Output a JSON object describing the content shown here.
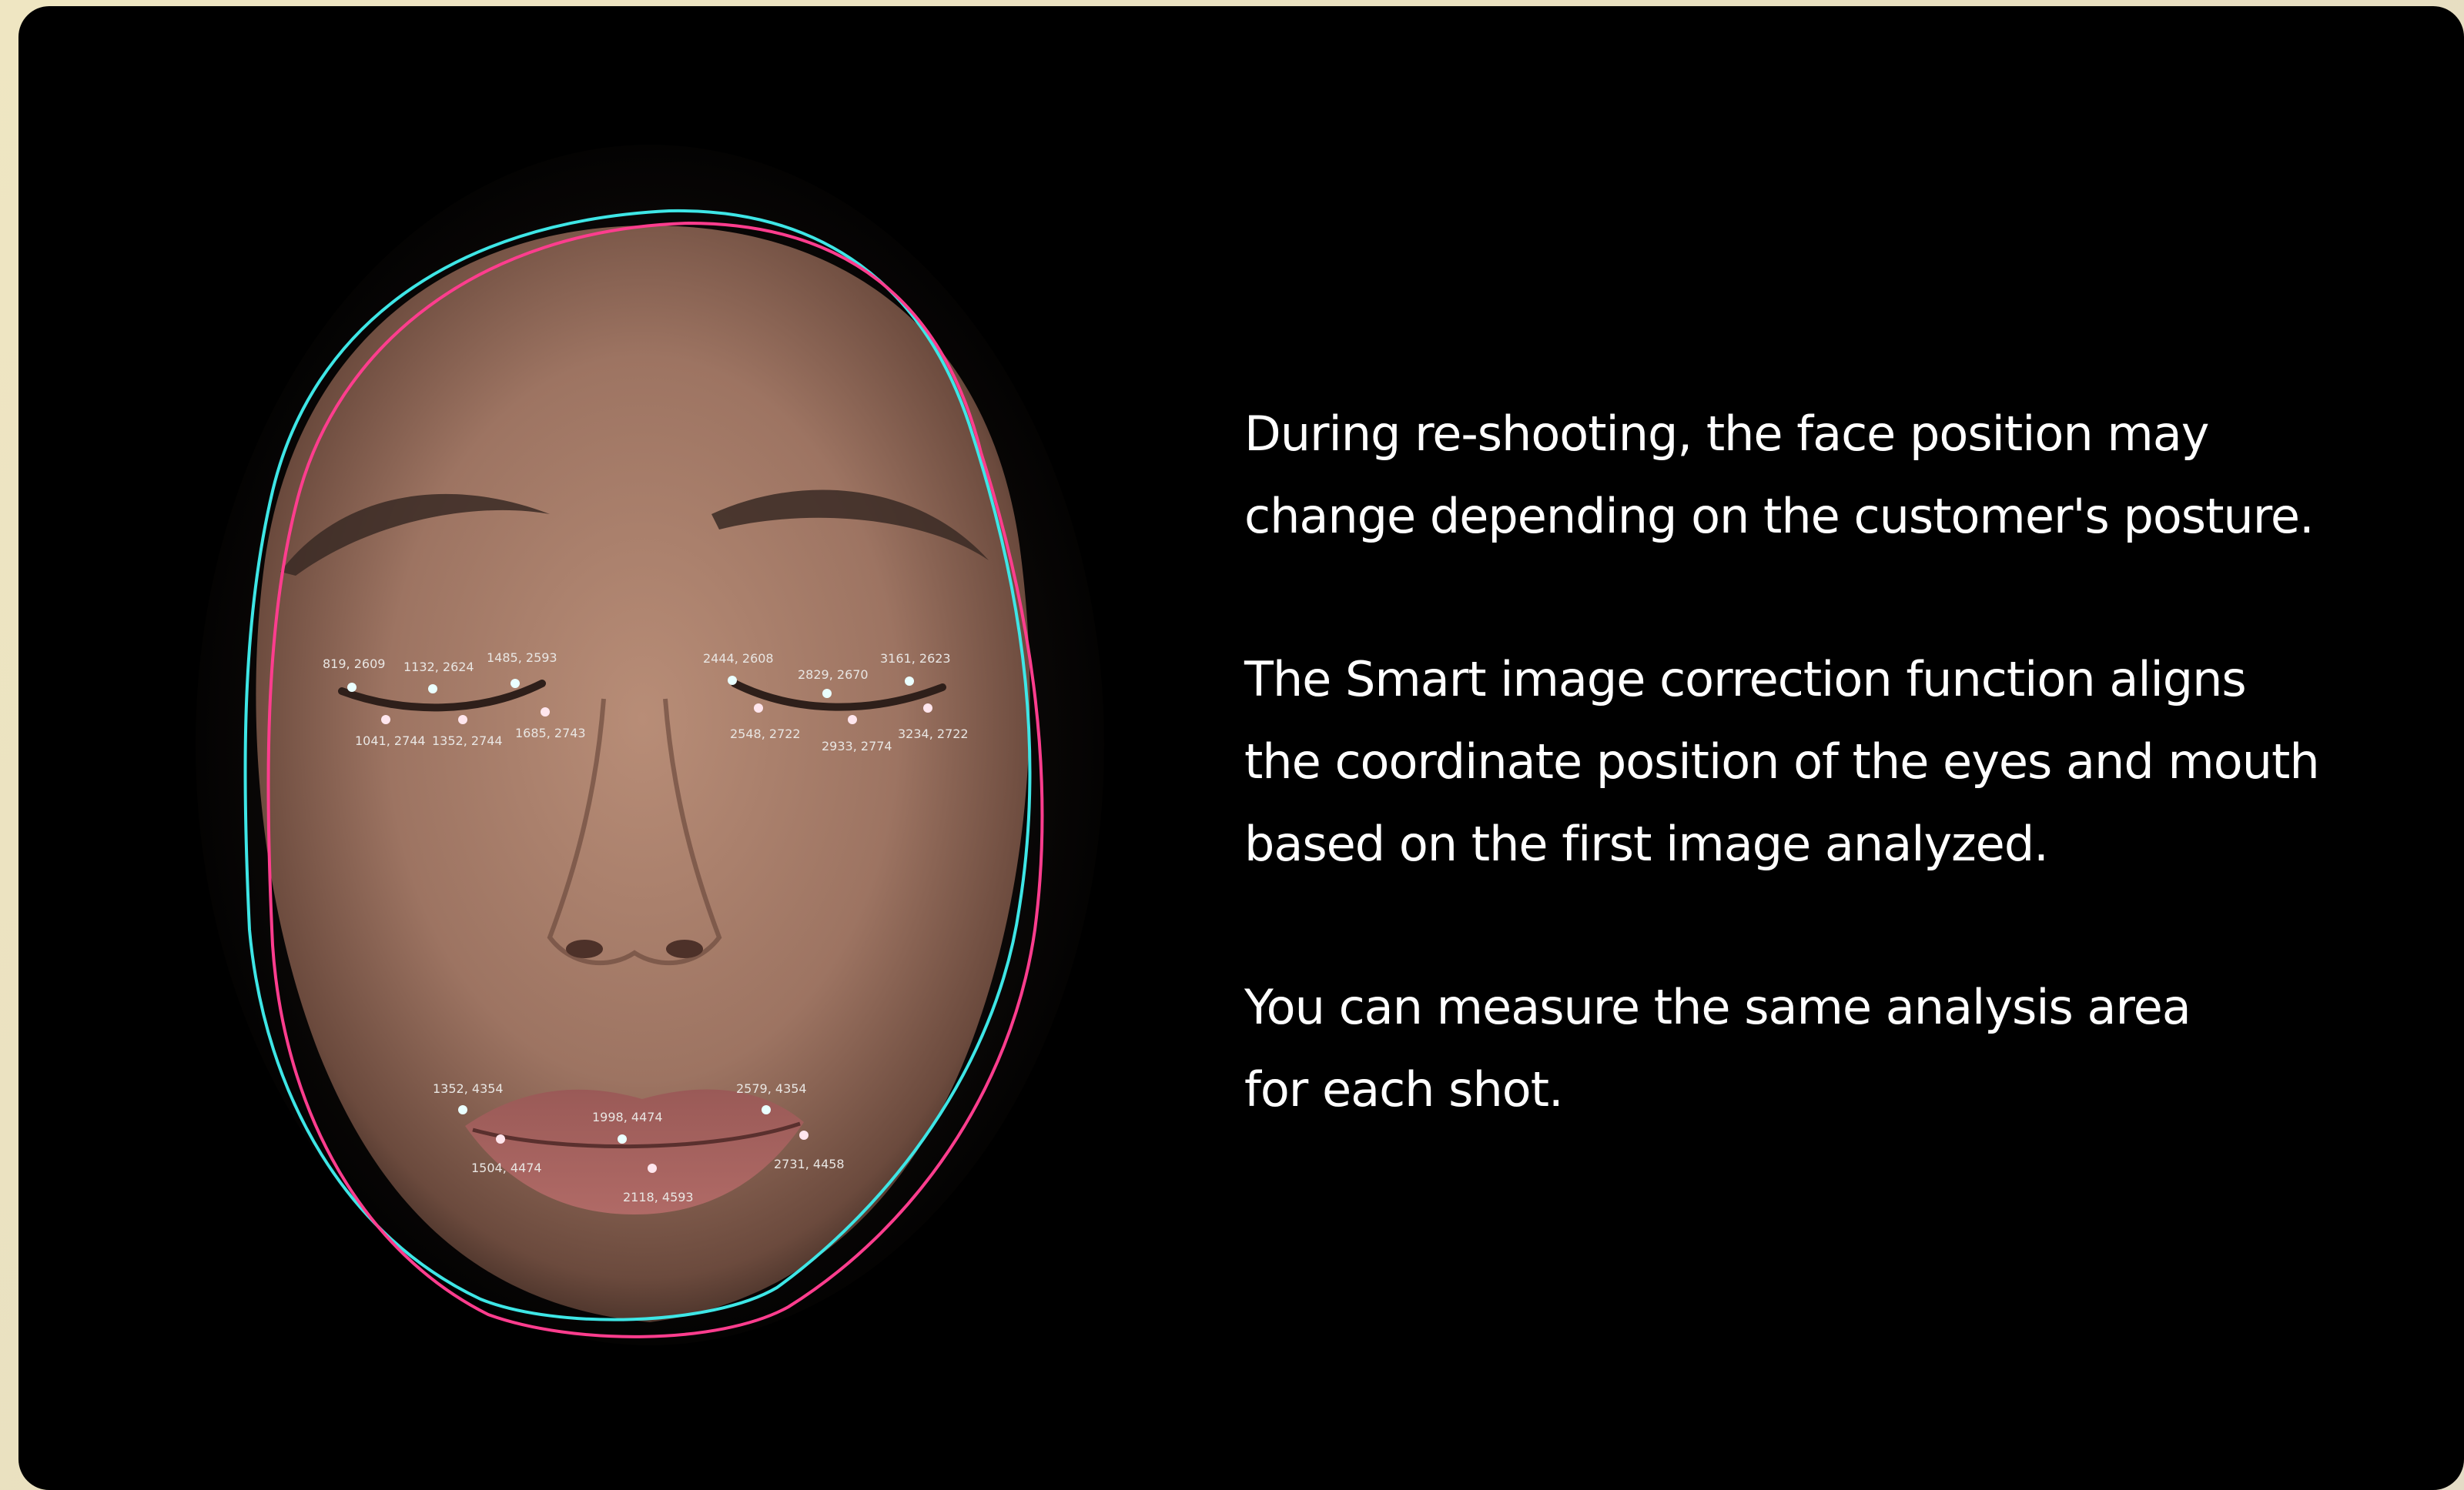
{
  "paragraphs": [
    "During re-shooting, the face position may\nchange depending on the customer's posture.",
    "The Smart image correction function aligns\nthe coordinate position of the eyes and mouth\nbased on the first image analyzed.",
    "You can measure the same analysis area\nfor each shot."
  ],
  "landmarks": {
    "reference_color": "#ffffff",
    "corrected_color": "#ff3d7a",
    "contour_reference_color": "#3ee6e6",
    "contour_corrected_color": "#ff3d8e",
    "left_eye_reference": [
      "819, 2609",
      "1132, 2624",
      "1485, 2593"
    ],
    "left_eye_corrected": [
      "1041, 2744",
      "1352, 2744",
      "1685, 2743"
    ],
    "right_eye_reference": [
      "2444, 2608",
      "2829, 2670",
      "3161, 2623"
    ],
    "right_eye_corrected": [
      "2548, 2722",
      "2933, 2774",
      "3234, 2722"
    ],
    "mouth_reference": [
      "1352, 4354",
      "1998, 4474",
      "2579, 4354"
    ],
    "mouth_corrected": [
      "1504, 4474",
      "2118, 4593",
      "2731, 4458"
    ]
  }
}
